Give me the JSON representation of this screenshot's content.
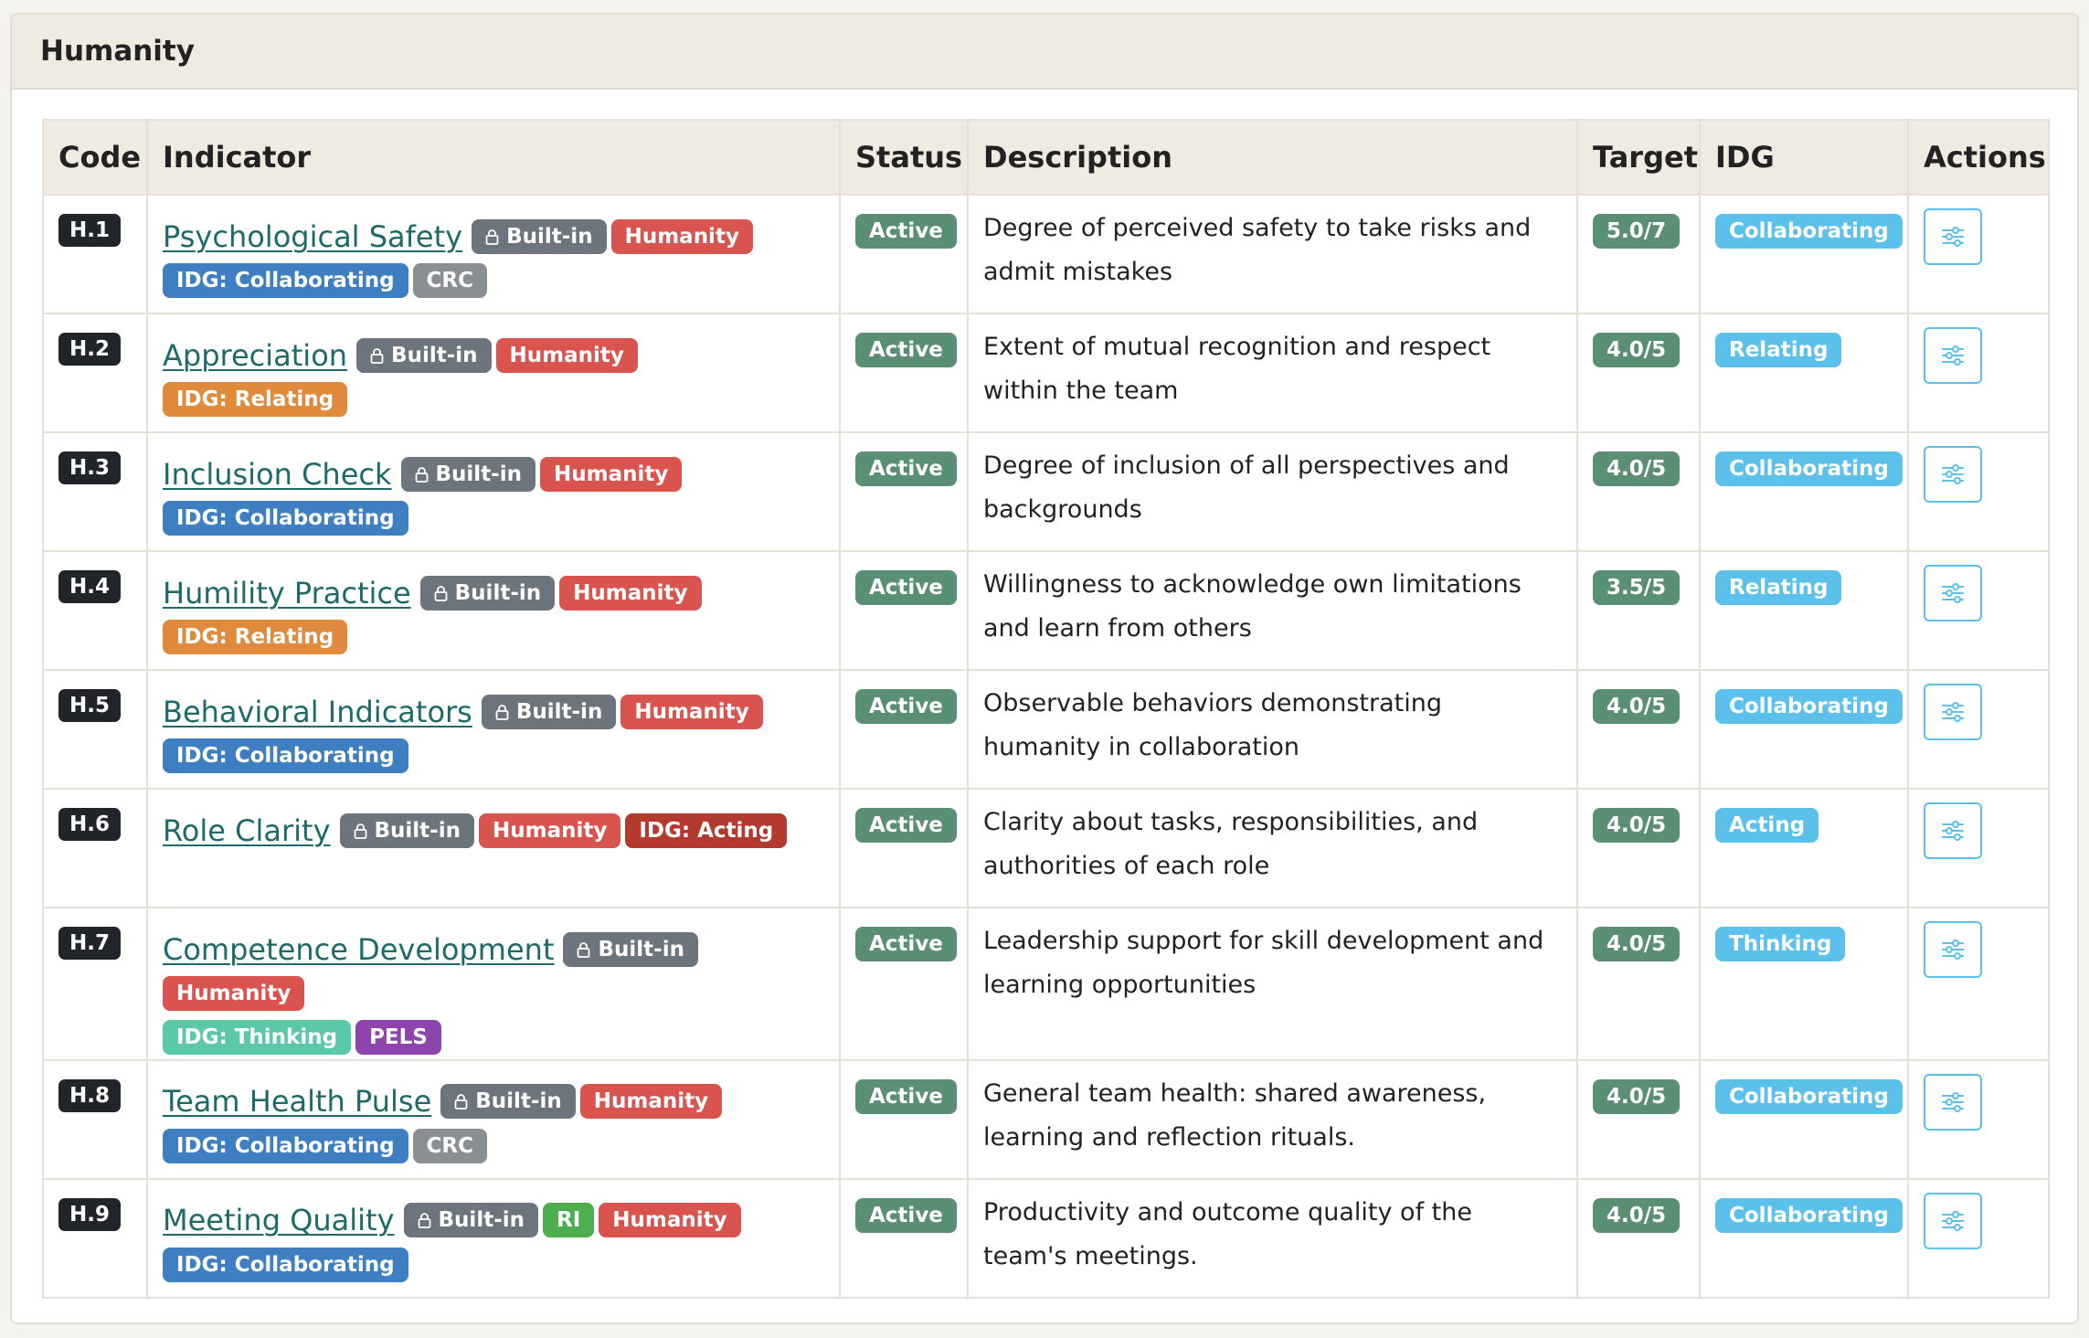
{
  "panel": {
    "title": "Humanity"
  },
  "table": {
    "headers": {
      "code": "Code",
      "indicator": "Indicator",
      "status": "Status",
      "description": "Description",
      "target": "Target",
      "idg": "IDG",
      "actions": "Actions"
    },
    "rows": [
      {
        "code": "H.1",
        "indicator": "Psychological Safety",
        "tags": [
          {
            "label": "Built-in",
            "kind": "builtin",
            "icon": "lock-icon"
          },
          {
            "label": "Humanity",
            "kind": "humanity"
          },
          {
            "label": "IDG: Collaborating",
            "kind": "collab"
          },
          {
            "label": "CRC",
            "kind": "crc"
          }
        ],
        "wrap_after": 2,
        "status": "Active",
        "description": "Degree of perceived safety to take risks and admit mistakes",
        "target": "5.0/7",
        "idg": "Collaborating"
      },
      {
        "code": "H.2",
        "indicator": "Appreciation",
        "tags": [
          {
            "label": "Built-in",
            "kind": "builtin",
            "icon": "lock-icon"
          },
          {
            "label": "Humanity",
            "kind": "humanity"
          },
          {
            "label": "IDG: Relating",
            "kind": "relating"
          }
        ],
        "wrap_after": 3,
        "status": "Active",
        "description": "Extent of mutual recognition and respect within the team",
        "target": "4.0/5",
        "idg": "Relating"
      },
      {
        "code": "H.3",
        "indicator": "Inclusion Check",
        "tags": [
          {
            "label": "Built-in",
            "kind": "builtin",
            "icon": "lock-icon"
          },
          {
            "label": "Humanity",
            "kind": "humanity"
          },
          {
            "label": "IDG: Collaborating",
            "kind": "collab"
          }
        ],
        "wrap_after": 2,
        "status": "Active",
        "description": "Degree of inclusion of all perspectives and backgrounds",
        "target": "4.0/5",
        "idg": "Collaborating"
      },
      {
        "code": "H.4",
        "indicator": "Humility Practice",
        "tags": [
          {
            "label": "Built-in",
            "kind": "builtin",
            "icon": "lock-icon"
          },
          {
            "label": "Humanity",
            "kind": "humanity"
          },
          {
            "label": "IDG: Relating",
            "kind": "relating"
          }
        ],
        "wrap_after": 2,
        "status": "Active",
        "description": "Willingness to acknowledge own limitations and learn from others",
        "target": "3.5/5",
        "idg": "Relating"
      },
      {
        "code": "H.5",
        "indicator": "Behavioral Indicators",
        "tags": [
          {
            "label": "Built-in",
            "kind": "builtin",
            "icon": "lock-icon"
          },
          {
            "label": "Humanity",
            "kind": "humanity"
          },
          {
            "label": "IDG: Collaborating",
            "kind": "collab"
          }
        ],
        "wrap_after": 2,
        "status": "Active",
        "description": "Observable behaviors demonstrating humanity in collaboration",
        "target": "4.0/5",
        "idg": "Collaborating"
      },
      {
        "code": "H.6",
        "indicator": "Role Clarity",
        "tags": [
          {
            "label": "Built-in",
            "kind": "builtin",
            "icon": "lock-icon"
          },
          {
            "label": "Humanity",
            "kind": "humanity"
          },
          {
            "label": "IDG: Acting",
            "kind": "acting"
          }
        ],
        "wrap_after": 3,
        "status": "Active",
        "description": "Clarity about tasks, responsibilities, and authorities of each role",
        "target": "4.0/5",
        "idg": "Acting"
      },
      {
        "code": "H.7",
        "indicator": "Competence Development",
        "tags": [
          {
            "label": "Built-in",
            "kind": "builtin",
            "icon": "lock-icon"
          },
          {
            "label": "Humanity",
            "kind": "humanity"
          },
          {
            "label": "IDG: Thinking",
            "kind": "thinking"
          },
          {
            "label": "PELS",
            "kind": "pels"
          }
        ],
        "wrap_after": 2,
        "status": "Active",
        "description": "Leadership support for skill development and learning opportunities",
        "target": "4.0/5",
        "idg": "Thinking"
      },
      {
        "code": "H.8",
        "indicator": "Team Health Pulse",
        "tags": [
          {
            "label": "Built-in",
            "kind": "builtin",
            "icon": "lock-icon"
          },
          {
            "label": "Humanity",
            "kind": "humanity"
          },
          {
            "label": "IDG: Collaborating",
            "kind": "collab"
          },
          {
            "label": "CRC",
            "kind": "crc"
          }
        ],
        "wrap_after": 2,
        "status": "Active",
        "description": "General team health: shared awareness, learning and reflection rituals.",
        "target": "4.0/5",
        "idg": "Collaborating"
      },
      {
        "code": "H.9",
        "indicator": "Meeting Quality",
        "tags": [
          {
            "label": "Built-in",
            "kind": "builtin",
            "icon": "lock-icon"
          },
          {
            "label": "RI",
            "kind": "ri"
          },
          {
            "label": "Humanity",
            "kind": "humanity"
          },
          {
            "label": "IDG: Collaborating",
            "kind": "collab"
          }
        ],
        "wrap_after": 3,
        "status": "Active",
        "description": "Productivity and outcome quality of the team's meetings.",
        "target": "4.0/5",
        "idg": "Collaborating"
      }
    ]
  },
  "colors": {
    "header_bg": "#efebe1",
    "link": "#1e6a6a",
    "status_green": "#5b8f73",
    "idg_blue": "#5bc0ea"
  }
}
